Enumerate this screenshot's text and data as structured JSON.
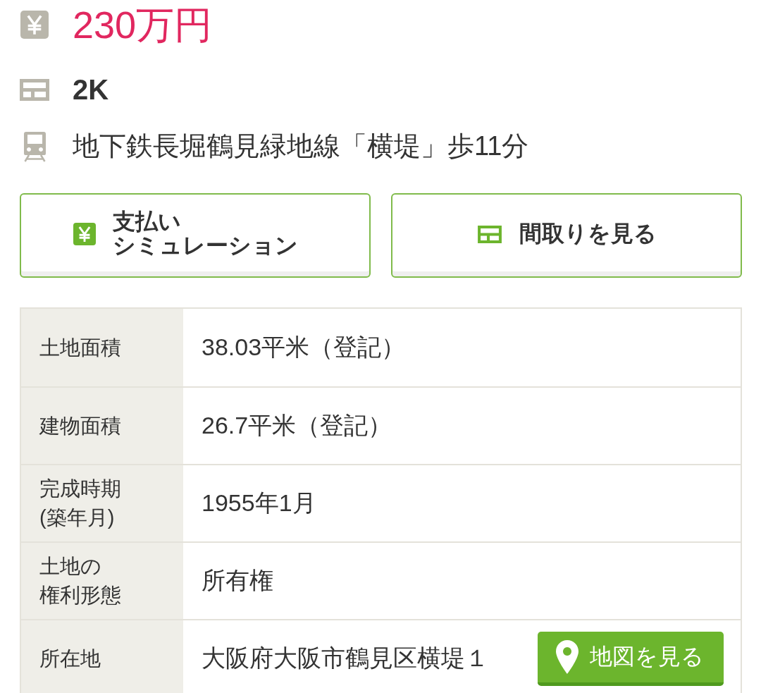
{
  "summary": [
    {
      "kind": "price",
      "text": "230万円"
    },
    {
      "kind": "layout",
      "text": "2K"
    },
    {
      "kind": "access",
      "text": "地下鉄長堀鶴見緑地線「横堤」歩11分"
    }
  ],
  "buttons": [
    {
      "kind": "payment",
      "label": "支払いシミュレーション"
    },
    {
      "kind": "floor_plan",
      "label": "間取りを見る"
    }
  ],
  "details": [
    {
      "label": "土地面積",
      "value": "38.03平米（登記）"
    },
    {
      "label": "建物面積",
      "value": "26.7平米（登記）"
    },
    {
      "label": "完成時期(築年月)",
      "value": "1955年1月"
    },
    {
      "label": "土地の権利形態",
      "value": "所有権"
    },
    {
      "label": "所在地",
      "value": "大阪府大阪市鶴見区横堤１",
      "action": {
        "kind": "map",
        "label": "地図を見る"
      }
    }
  ]
}
